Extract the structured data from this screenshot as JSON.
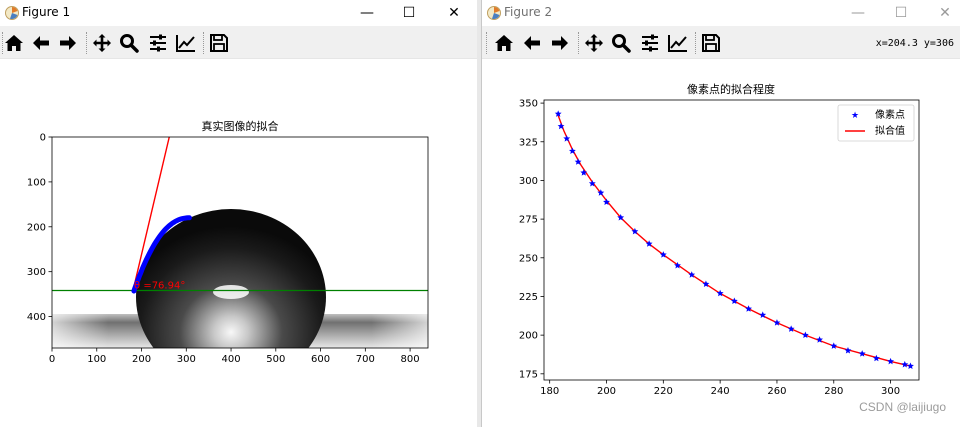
{
  "figure1": {
    "window_title": "Figure 1",
    "plot_title": "真实图像的拟合",
    "angle_label": "θ =76.94°",
    "x_ticks": [
      "0",
      "100",
      "200",
      "300",
      "400",
      "500",
      "600",
      "700",
      "800"
    ],
    "y_ticks": [
      "0",
      "100",
      "200",
      "300",
      "400"
    ],
    "xlim": [
      0,
      840
    ],
    "ylim": [
      470,
      0
    ],
    "baseline_y": 342,
    "contact_point": [
      181,
      342
    ],
    "tangent_top": [
      262,
      0
    ],
    "fit_arc": {
      "x_start": 183,
      "x_end": 307,
      "y_start": 343,
      "y_end": 180
    },
    "colors": {
      "tangent": "#ff0000",
      "baseline": "#008000",
      "points": "#0000ff",
      "label": "#ff0000"
    }
  },
  "figure2": {
    "window_title": "Figure 2",
    "coordinates": "x=204.3 y=306",
    "chart_data": {
      "type": "scatter",
      "title": "像素点的拟合程度",
      "xlabel": "",
      "ylabel": "",
      "xlim": [
        178,
        310
      ],
      "ylim": [
        171,
        352
      ],
      "x_ticks": [
        "180",
        "200",
        "220",
        "240",
        "260",
        "280",
        "300"
      ],
      "y_ticks": [
        "175",
        "200",
        "225",
        "250",
        "275",
        "300",
        "325",
        "350"
      ],
      "legend_position": "top-right",
      "series": [
        {
          "name": "像素点",
          "marker": "star",
          "color": "#0000ff",
          "x": [
            183,
            184,
            186,
            188,
            190,
            192,
            195,
            198,
            200,
            205,
            210,
            215,
            220,
            225,
            230,
            235,
            240,
            245,
            250,
            255,
            260,
            265,
            270,
            275,
            280,
            285,
            290,
            295,
            300,
            305,
            307
          ],
          "y": [
            343,
            335,
            327,
            319,
            312,
            305,
            298,
            292,
            286,
            276,
            267,
            259,
            252,
            245,
            239,
            233,
            227,
            222,
            217,
            213,
            208,
            204,
            200,
            197,
            193,
            190,
            188,
            185,
            183,
            181,
            180
          ]
        },
        {
          "name": "拟合值",
          "marker": "line",
          "color": "#ff0000",
          "x": [
            183,
            185,
            188,
            191,
            195,
            200,
            205,
            210,
            215,
            220,
            230,
            240,
            250,
            260,
            270,
            280,
            290,
            300,
            307
          ],
          "y": [
            342,
            332,
            320,
            310,
            299,
            287,
            276,
            267,
            259,
            252,
            239,
            227,
            217,
            208,
            200,
            193,
            188,
            183,
            180
          ]
        }
      ]
    }
  },
  "toolbar": {
    "buttons": [
      {
        "name": "home",
        "icon": "home-icon",
        "tooltip": "Reset original view"
      },
      {
        "name": "back",
        "icon": "arrow-left-icon",
        "tooltip": "Back"
      },
      {
        "name": "forward",
        "icon": "arrow-right-icon",
        "tooltip": "Forward"
      },
      {
        "name": "pan",
        "icon": "move-icon",
        "tooltip": "Pan axes"
      },
      {
        "name": "zoom",
        "icon": "magnifier-icon",
        "tooltip": "Zoom to rectangle"
      },
      {
        "name": "subplots",
        "icon": "sliders-icon",
        "tooltip": "Configure subplots"
      },
      {
        "name": "customize",
        "icon": "line-chart-icon",
        "tooltip": "Edit axis"
      },
      {
        "name": "save",
        "icon": "floppy-disk-icon",
        "tooltip": "Save the figure"
      }
    ]
  },
  "window_controls": {
    "minimize": "—",
    "maximize": "☐",
    "close": "✕"
  },
  "watermark": "CSDN @laijiugo"
}
